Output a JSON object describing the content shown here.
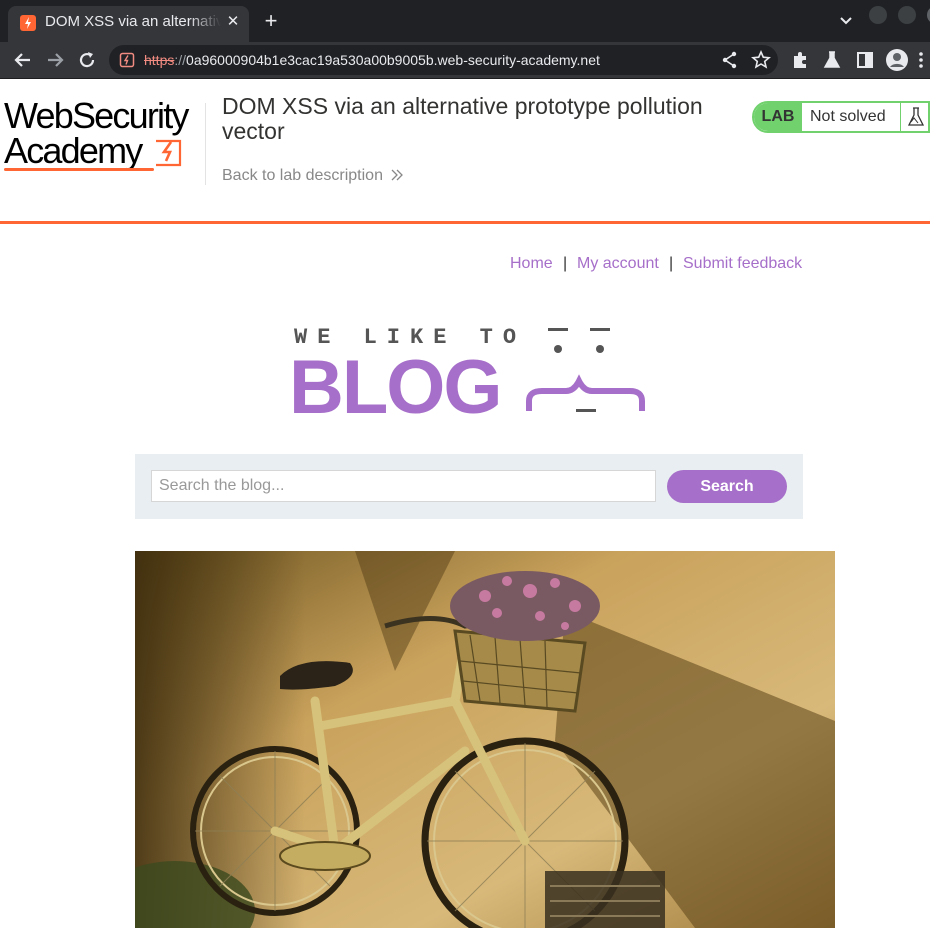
{
  "browser": {
    "tab_title": "DOM XSS via an alternative prototype pollution vector",
    "tab_close": "✕",
    "new_tab": "+",
    "url_scheme": "https",
    "url_sep": "://",
    "url_host": "0a96000904b1e3cac19a530a00b9005b.web-security-academy.net",
    "icons": [
      "back-icon",
      "forward-icon",
      "reload-icon",
      "share-icon",
      "star-icon",
      "extensions-icon",
      "labs-icon",
      "sidepanel-icon",
      "profile-icon",
      "menu-icon"
    ]
  },
  "header": {
    "logo_line1": "WebSecurity",
    "logo_line2": "Academy",
    "lab_title": "DOM XSS via an alternative prototype pollution vector",
    "back_link": "Back to lab description",
    "status_badge": "LAB",
    "status_text": "Not solved"
  },
  "nav": {
    "home": "Home",
    "sep1": "|",
    "my_account": "My account",
    "sep2": "|",
    "submit_feedback": "Submit feedback"
  },
  "banner": {
    "tagline": "WE LIKE TO",
    "title": "BLOG"
  },
  "search": {
    "placeholder": "Search the blog...",
    "button_label": "Search"
  },
  "colors": {
    "accent_orange": "#ff6633",
    "lab_green": "#70d16d",
    "blog_purple": "#a66fc9"
  }
}
